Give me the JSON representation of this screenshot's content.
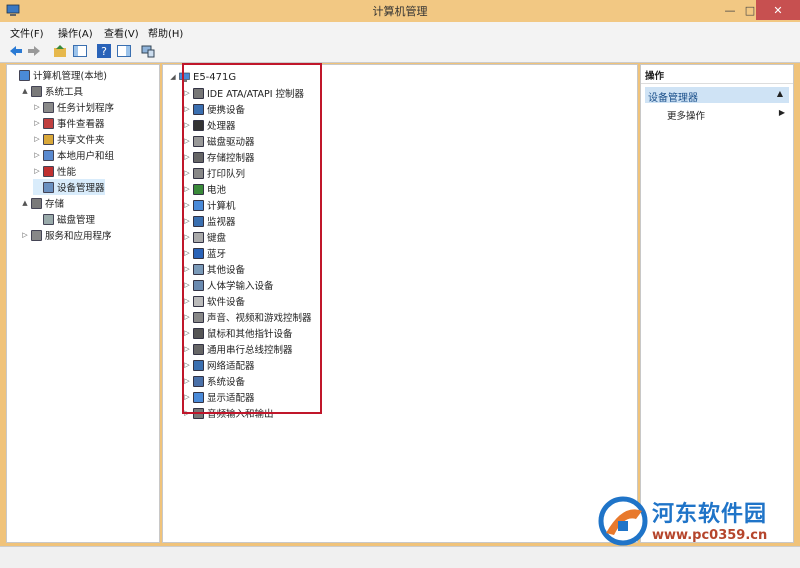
{
  "window": {
    "title": "计算机管理"
  },
  "menu": [
    "文件(F)",
    "操作(A)",
    "查看(V)",
    "帮助(H)"
  ],
  "left_tree": [
    {
      "label": "计算机管理(本地)",
      "level": 0,
      "expand": ""
    },
    {
      "label": "系统工具",
      "level": 1,
      "expand": "▲"
    },
    {
      "label": "任务计划程序",
      "level": 2,
      "expand": "▷"
    },
    {
      "label": "事件查看器",
      "level": 2,
      "expand": "▷"
    },
    {
      "label": "共享文件夹",
      "level": 2,
      "expand": "▷"
    },
    {
      "label": "本地用户和组",
      "level": 2,
      "expand": "▷"
    },
    {
      "label": "性能",
      "level": 2,
      "expand": "▷"
    },
    {
      "label": "设备管理器",
      "level": 2,
      "expand": "",
      "selected": true
    },
    {
      "label": "存储",
      "level": 1,
      "expand": "▲"
    },
    {
      "label": "磁盘管理",
      "level": 2,
      "expand": ""
    },
    {
      "label": "服务和应用程序",
      "level": 1,
      "expand": "▷"
    }
  ],
  "device_tree": {
    "root": "E5-471G",
    "items": [
      "IDE ATA/ATAPI 控制器",
      "便携设备",
      "处理器",
      "磁盘驱动器",
      "存储控制器",
      "打印队列",
      "电池",
      "计算机",
      "监视器",
      "键盘",
      "蓝牙",
      "其他设备",
      "人体学输入设备",
      "软件设备",
      "声音、视频和游戏控制器",
      "鼠标和其他指针设备",
      "通用串行总线控制器",
      "网络适配器",
      "系统设备",
      "显示适配器",
      "音频输入和输出"
    ]
  },
  "actions": {
    "header": "操作",
    "section": "设备管理器",
    "more": "更多操作"
  },
  "watermark": {
    "name": "河东软件园",
    "url": "www.pc0359.cn"
  },
  "colors": {
    "title_bar": "#f2c883",
    "highlight_box": "#c0162a",
    "selection": "#cfe3f5"
  }
}
